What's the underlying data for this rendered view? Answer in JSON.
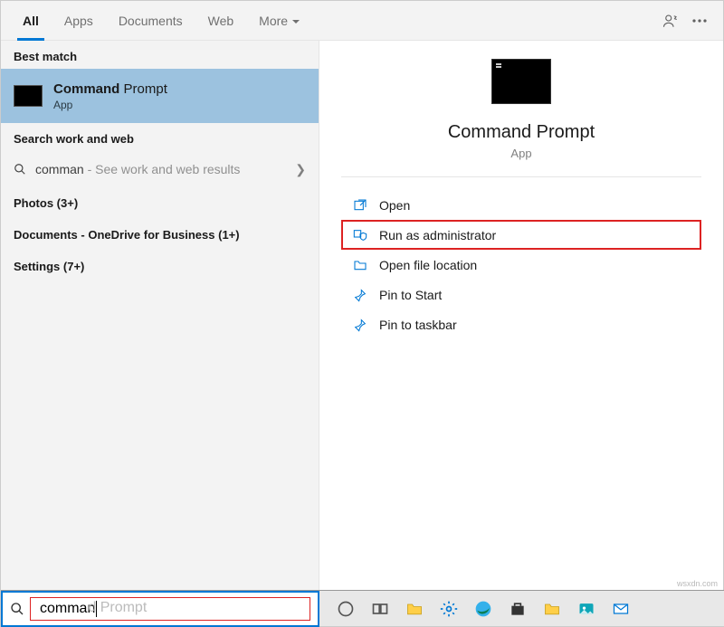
{
  "tabs": {
    "all": "All",
    "apps": "Apps",
    "documents": "Documents",
    "web": "Web",
    "more": "More"
  },
  "left": {
    "best_match_label": "Best match",
    "best_match": {
      "title_bold": "Command",
      "title_rest": " Prompt",
      "subtitle": "App"
    },
    "search_section_label": "Search work and web",
    "search_row": {
      "typed": "comman",
      "hint": " - See work and web results"
    },
    "categories": {
      "photos": "Photos (3+)",
      "documents": "Documents - OneDrive for Business (1+)",
      "settings": "Settings (7+)"
    }
  },
  "right": {
    "title": "Command Prompt",
    "subtitle": "App",
    "actions": {
      "open": "Open",
      "run_admin": "Run as administrator",
      "open_loc": "Open file location",
      "pin_start": "Pin to Start",
      "pin_taskbar": "Pin to taskbar"
    }
  },
  "search": {
    "typed": "comman",
    "ghost_full": "command Prompt"
  },
  "watermark": "wsxdn.com"
}
